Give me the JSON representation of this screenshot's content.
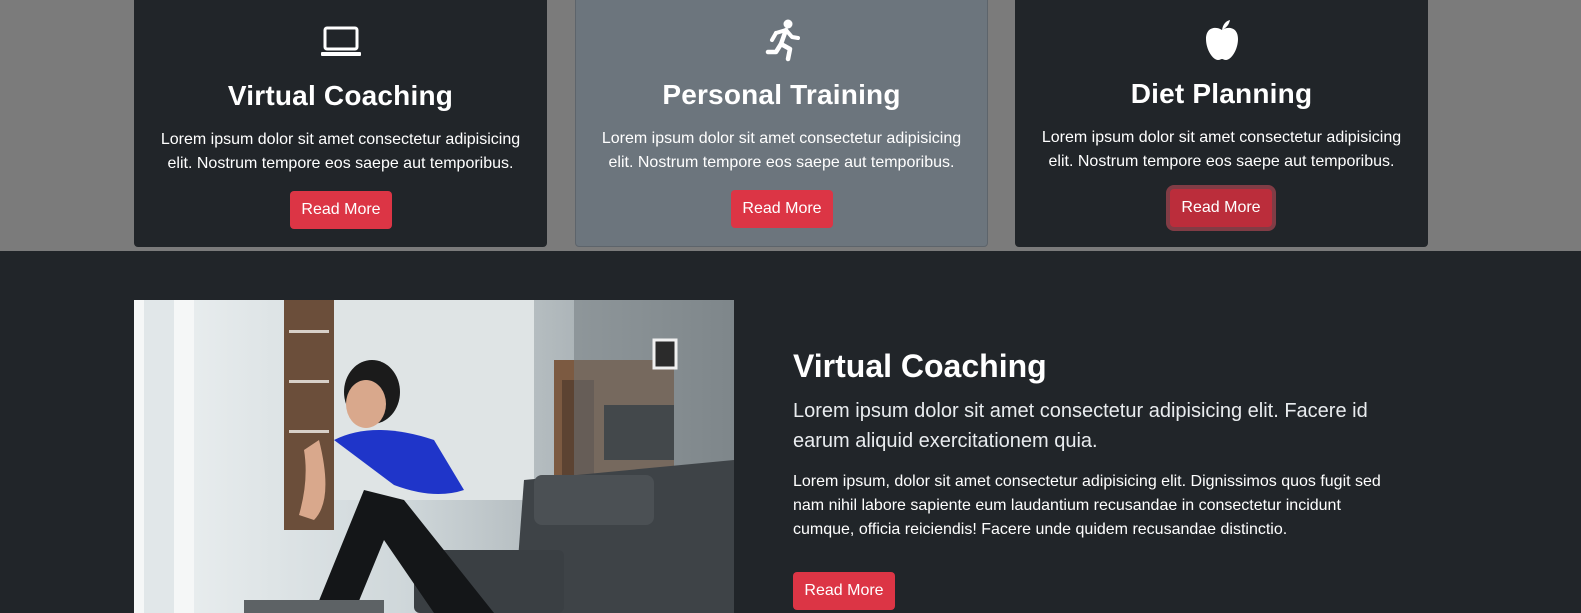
{
  "cards": [
    {
      "icon": "laptop-icon",
      "title": "Virtual Coaching",
      "text": "Lorem ipsum dolor sit amet consectetur adipisicing elit. Nostrum tempore eos saepe aut temporibus.",
      "button": "Read More"
    },
    {
      "icon": "running-icon",
      "title": "Personal Training",
      "text": "Lorem ipsum dolor sit amet consectetur adipisicing elit. Nostrum tempore eos saepe aut temporibus.",
      "button": "Read More"
    },
    {
      "icon": "apple-icon",
      "title": "Diet Planning",
      "text": "Lorem ipsum dolor sit amet consectetur adipisicing elit. Nostrum tempore eos saepe aut temporibus.",
      "button": "Read More"
    }
  ],
  "feature": {
    "title": "Virtual Coaching",
    "lead": "Lorem ipsum dolor sit amet consectetur adipisicing elit. Facere id earum aliquid exercitationem quia.",
    "body": "Lorem ipsum, dolor sit amet consectetur adipisicing elit. Dignissimos quos fugit sed nam nihil labore sapiente eum laudantium recusandae in consectetur incidunt cumque, officia reiciendis! Facere unde quidem recusandae distinctio.",
    "button": "Read More"
  },
  "colors": {
    "accent": "#dc3545",
    "dark": "#212529",
    "secondary": "#6c757d",
    "band": "#7b7b7b"
  }
}
